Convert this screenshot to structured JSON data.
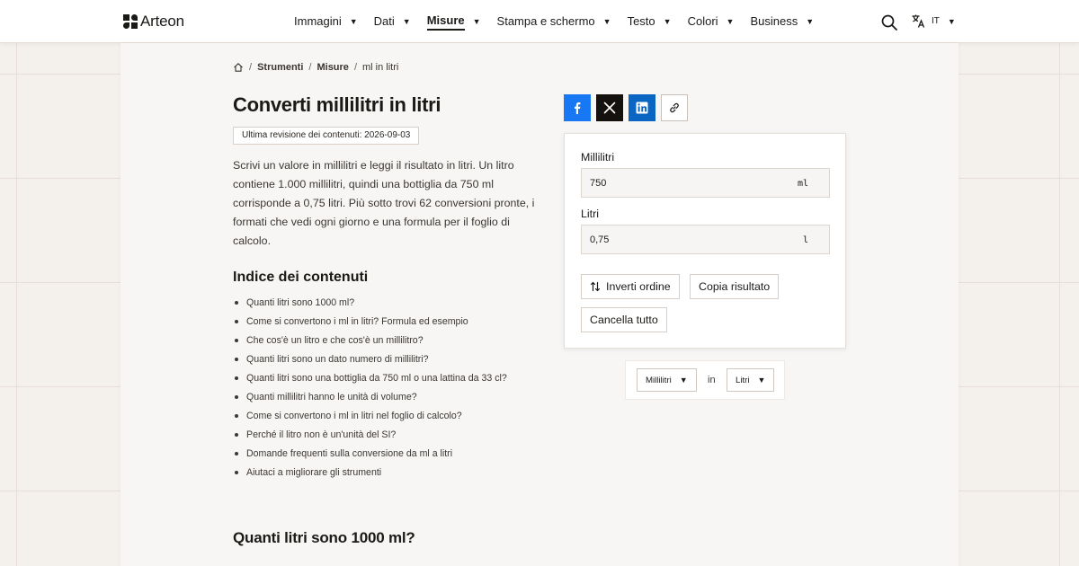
{
  "header": {
    "brand": "Arteon",
    "nav": [
      {
        "label": "Immagini",
        "active": false
      },
      {
        "label": "Dati",
        "active": false
      },
      {
        "label": "Misure",
        "active": true
      },
      {
        "label": "Stampa e schermo",
        "active": false
      },
      {
        "label": "Testo",
        "active": false
      },
      {
        "label": "Colori",
        "active": false
      },
      {
        "label": "Business",
        "active": false
      }
    ],
    "caret": "▼",
    "language": "IT"
  },
  "breadcrumb": {
    "items": [
      "Strumenti",
      "Misure",
      "ml in litri"
    ],
    "separator": "/"
  },
  "page": {
    "title": "Converti millilitri in litri",
    "revision": "Ultima revisione dei contenuti: 2026-09-03",
    "intro": "Scrivi un valore in millilitri e leggi il risultato in litri. Un litro contiene 1.000 millilitri, quindi una bottiglia da 750 ml corrisponde a 0,75 litri. Più sotto trovi 62 conversioni pronte, i formati che vedi ogni giorno e una formula per il foglio di calcolo.",
    "toc_title": "Indice dei contenuti",
    "toc": [
      "Quanti litri sono 1000 ml?",
      "Come si convertono i ml in litri? Formula ed esempio",
      "Che cos'è un litro e che cos'è un millilitro?",
      "Quanti litri sono un dato numero di millilitri?",
      "Quanti litri sono una bottiglia da 750 ml o una lattina da 33 cl?",
      "Quanti millilitri hanno le unità di volume?",
      "Come si convertono i ml in litri nel foglio di calcolo?",
      "Perché il litro non è un'unità del SI?",
      "Domande frequenti sulla conversione da ml a litri",
      "Aiutaci a migliorare gli strumenti"
    ],
    "section_title": "Quanti litri sono 1000 ml?"
  },
  "share": {
    "colors": {
      "facebook": "#1877f2",
      "x": "#14110f",
      "linkedin": "#0a66c2"
    }
  },
  "converter": {
    "from_label": "Millilitri",
    "from_value": "750",
    "from_unit": "ml",
    "to_label": "Litri",
    "to_value": "0,75",
    "to_unit": "l",
    "swap_label": "Inverti ordine",
    "copy_label": "Copia risultato",
    "clear_label": "Cancella tutto"
  },
  "unit_select": {
    "from": "Millilitri",
    "connector": "in",
    "to": "Litri"
  }
}
